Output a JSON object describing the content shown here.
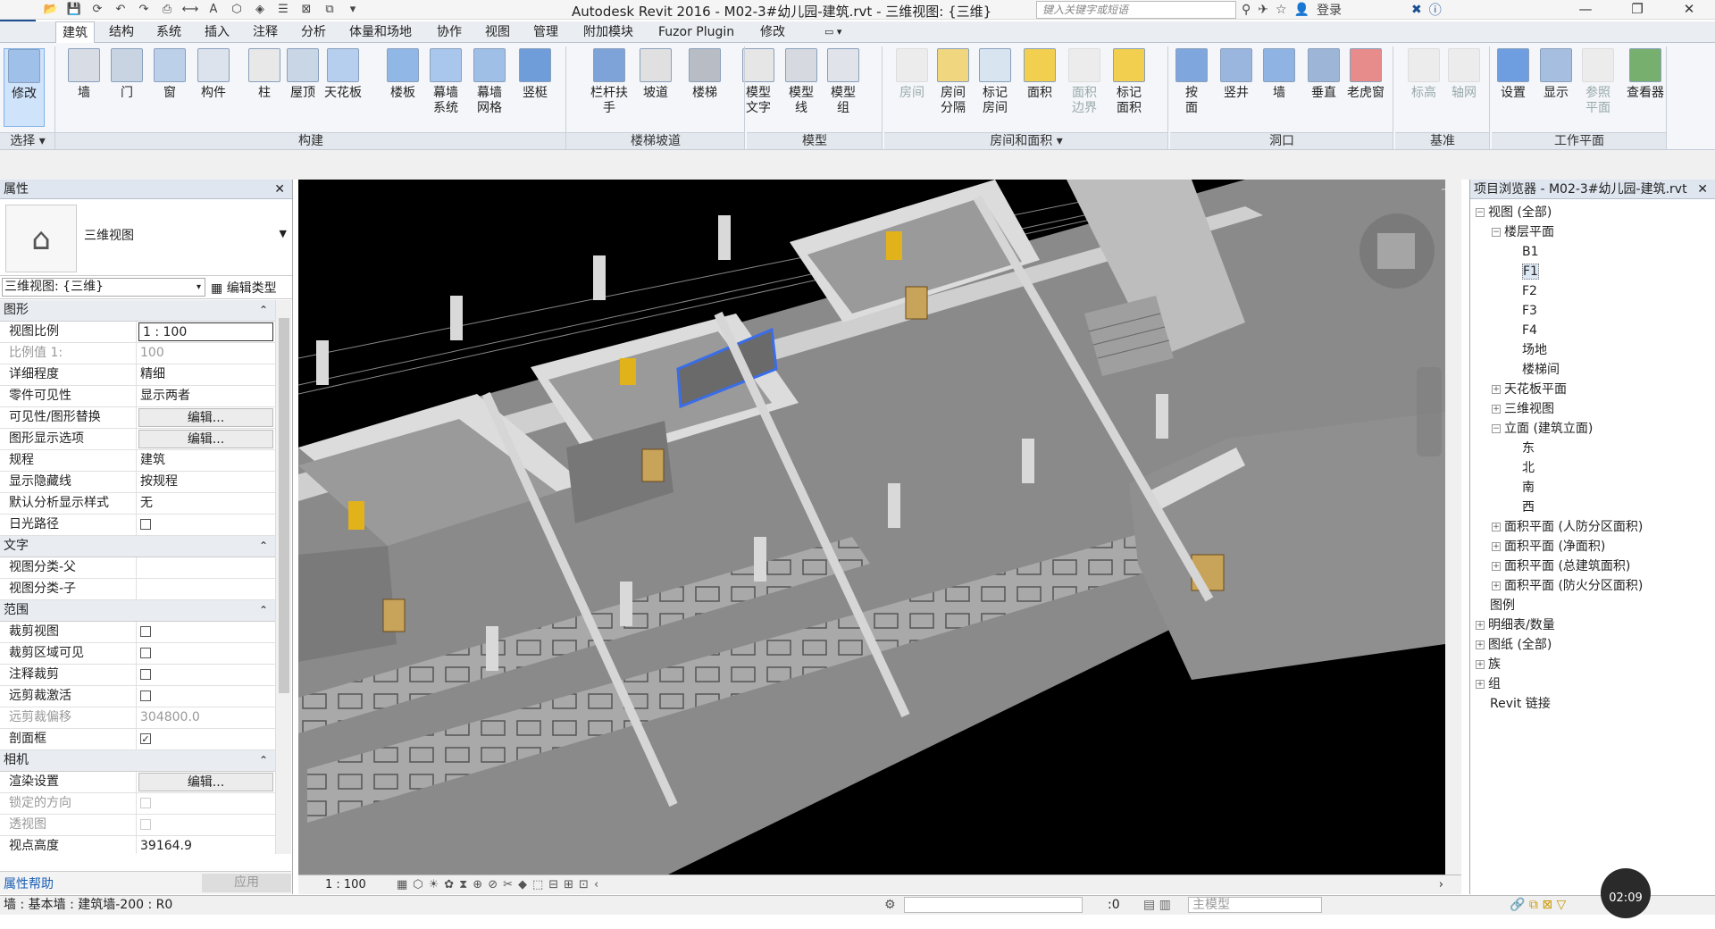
{
  "app": {
    "logo": "R",
    "title": "Autodesk Revit 2016 -      M02-3#幼儿园-建筑.rvt - 三维视图: {三维}",
    "search_placeholder": "键入关键字或短语",
    "login": "登录",
    "window_buttons": [
      "—",
      "❐",
      "✕"
    ]
  },
  "tabs": [
    "建筑",
    "结构",
    "系统",
    "插入",
    "注释",
    "分析",
    "体量和场地",
    "协作",
    "视图",
    "管理",
    "附加模块",
    "Fuzor Plugin",
    "修改"
  ],
  "ribbon": {
    "buttons": [
      {
        "label": "修改",
        "sel": true
      },
      {
        "label": "墙"
      },
      {
        "label": "门"
      },
      {
        "label": "窗"
      },
      {
        "label": "构件"
      },
      {
        "label": "柱"
      },
      {
        "label": "屋顶"
      },
      {
        "label": "天花板"
      },
      {
        "label": "楼板"
      },
      {
        "label": "幕墙\n系统"
      },
      {
        "label": "幕墙\n网格"
      },
      {
        "label": "竖梃"
      },
      {
        "label": "栏杆扶手"
      },
      {
        "label": "坡道"
      },
      {
        "label": "楼梯"
      },
      {
        "label": "模型\n文字"
      },
      {
        "label": "模型\n线"
      },
      {
        "label": "模型\n组"
      },
      {
        "label": "房间",
        "dis": true
      },
      {
        "label": "房间\n分隔"
      },
      {
        "label": "标记\n房间"
      },
      {
        "label": "面积"
      },
      {
        "label": "面积\n边界",
        "dis": true
      },
      {
        "label": "标记\n面积"
      },
      {
        "label": "按\n面"
      },
      {
        "label": "竖井"
      },
      {
        "label": "墙"
      },
      {
        "label": "垂直"
      },
      {
        "label": "老虎窗"
      },
      {
        "label": "标高",
        "dis": true
      },
      {
        "label": "轴网",
        "dis": true
      },
      {
        "label": "设置"
      },
      {
        "label": "显示"
      },
      {
        "label": "参照\n平面",
        "dis": true
      },
      {
        "label": "查看器"
      }
    ],
    "panels": [
      "选择 ▾",
      "构建",
      "楼梯坡道",
      "模型",
      "房间和面积 ▾",
      "洞口",
      "基准",
      "工作平面"
    ]
  },
  "properties": {
    "header": "属性",
    "type_name": "三维视图",
    "instance_selector": "三维视图: {三维}",
    "edit_type": "编辑类型",
    "rows": [
      {
        "group": "图形"
      },
      {
        "k": "视图比例",
        "v": "1 : 100",
        "kind": "input"
      },
      {
        "k": "比例值 1:",
        "v": "100",
        "dis": true
      },
      {
        "k": "详细程度",
        "v": "精细"
      },
      {
        "k": "零件可见性",
        "v": "显示两者"
      },
      {
        "k": "可见性/图形替换",
        "v": "编辑...",
        "kind": "btn"
      },
      {
        "k": "图形显示选项",
        "v": "编辑...",
        "kind": "btn"
      },
      {
        "k": "规程",
        "v": "建筑"
      },
      {
        "k": "显示隐藏线",
        "v": "按规程"
      },
      {
        "k": "默认分析显示样式",
        "v": "无"
      },
      {
        "k": "日光路径",
        "v": "",
        "kind": "cb"
      },
      {
        "group": "文字"
      },
      {
        "k": "视图分类-父",
        "v": ""
      },
      {
        "k": "视图分类-子",
        "v": ""
      },
      {
        "group": "范围"
      },
      {
        "k": "裁剪视图",
        "v": "",
        "kind": "cb"
      },
      {
        "k": "裁剪区域可见",
        "v": "",
        "kind": "cb"
      },
      {
        "k": "注释裁剪",
        "v": "",
        "kind": "cb"
      },
      {
        "k": "远剪裁激活",
        "v": "",
        "kind": "cb"
      },
      {
        "k": "远剪裁偏移",
        "v": "304800.0",
        "dis": true
      },
      {
        "k": "剖面框",
        "v": "✓",
        "kind": "cb"
      },
      {
        "group": "相机"
      },
      {
        "k": "渲染设置",
        "v": "编辑...",
        "kind": "btn"
      },
      {
        "k": "锁定的方向",
        "v": "",
        "kind": "cb",
        "dis": true
      },
      {
        "k": "透视图",
        "v": "",
        "kind": "cb",
        "dis": true
      },
      {
        "k": "视点高度",
        "v": "39164.9"
      }
    ],
    "help": "属性帮助",
    "apply": "应用"
  },
  "viewport": {
    "scale": "1 : 100"
  },
  "browser": {
    "header": "项目浏览器 - M02-3#幼儿园-建筑.rvt",
    "nodes": [
      {
        "t": "视图 (全部)",
        "lvl": 0,
        "tg": "−"
      },
      {
        "t": "楼层平面",
        "lvl": 1,
        "tg": "−"
      },
      {
        "t": "B1",
        "lvl": 2
      },
      {
        "t": "F1",
        "lvl": 2,
        "sel": true
      },
      {
        "t": "F2",
        "lvl": 2
      },
      {
        "t": "F3",
        "lvl": 2
      },
      {
        "t": "F4",
        "lvl": 2
      },
      {
        "t": "场地",
        "lvl": 2
      },
      {
        "t": "楼梯间",
        "lvl": 2
      },
      {
        "t": "天花板平面",
        "lvl": 1,
        "tg": "+"
      },
      {
        "t": "三维视图",
        "lvl": 1,
        "tg": "+"
      },
      {
        "t": "立面 (建筑立面)",
        "lvl": 1,
        "tg": "−"
      },
      {
        "t": "东",
        "lvl": 2
      },
      {
        "t": "北",
        "lvl": 2
      },
      {
        "t": "南",
        "lvl": 2
      },
      {
        "t": "西",
        "lvl": 2
      },
      {
        "t": "面积平面 (人防分区面积)",
        "lvl": 1,
        "tg": "+"
      },
      {
        "t": "面积平面 (净面积)",
        "lvl": 1,
        "tg": "+"
      },
      {
        "t": "面积平面 (总建筑面积)",
        "lvl": 1,
        "tg": "+"
      },
      {
        "t": "面积平面 (防火分区面积)",
        "lvl": 1,
        "tg": "+"
      },
      {
        "t": "图例",
        "lvl": 0
      },
      {
        "t": "明细表/数量",
        "lvl": 0,
        "tg": "+"
      },
      {
        "t": "图纸 (全部)",
        "lvl": 0,
        "tg": "+"
      },
      {
        "t": "族",
        "lvl": 0,
        "tg": "+"
      },
      {
        "t": "组",
        "lvl": 0,
        "tg": "+"
      },
      {
        "t": "Revit 链接",
        "lvl": 0
      }
    ]
  },
  "status": {
    "text": "墙 : 基本墙 : 建筑墙-200 : R0",
    "count": ":0",
    "model": "主模型",
    "timer": "02:09"
  },
  "colors": {
    "accent": "#1b4e92",
    "viewport_bg": "#000000",
    "floor": "#8a8a8a",
    "wall_top": "#d9d9d9",
    "door": "#e1b21a"
  }
}
